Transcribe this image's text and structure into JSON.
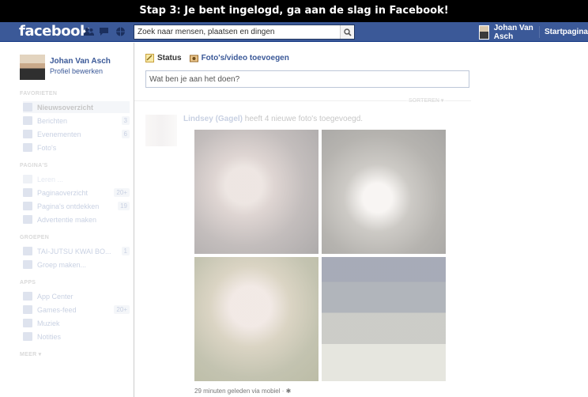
{
  "caption": "Stap 3:  Je bent ingelogd, ga aan de slag in Facebook!",
  "topbar": {
    "logo": "facebook",
    "search_placeholder": "Zoek naar mensen, plaatsen en dingen",
    "user_name": "Johan Van Asch",
    "home_label": "Startpagina",
    "icons": [
      "friend-requests-icon",
      "messages-icon",
      "notifications-icon",
      "search-icon"
    ],
    "colors": {
      "bar": "#3b5998",
      "link": "#3b5998"
    }
  },
  "sidebar": {
    "profile_name": "Johan Van Asch",
    "profile_edit": "Profiel bewerken",
    "sections": [
      {
        "title": "FAVORIETEN",
        "items": [
          {
            "label": "Nieuwsoverzicht",
            "selected": true
          },
          {
            "label": "Berichten",
            "count": "3"
          },
          {
            "label": "Evenementen",
            "count": "6"
          },
          {
            "label": "Foto's"
          }
        ]
      },
      {
        "title": "PAGINA'S",
        "items": [
          {
            "label": "Leren ..."
          },
          {
            "label": "Paginaoverzicht",
            "count": "20+"
          },
          {
            "label": "Pagina's ontdekken",
            "count": "19"
          },
          {
            "label": "Advertentie maken"
          }
        ]
      },
      {
        "title": "GROEPEN",
        "items": [
          {
            "label": "TAI-JUTSU KWAI BO...",
            "count": "1"
          },
          {
            "label": "Groep maken..."
          }
        ]
      },
      {
        "title": "APPS",
        "items": [
          {
            "label": "App Center"
          },
          {
            "label": "Games-feed",
            "count": "20+"
          },
          {
            "label": "Muziek"
          },
          {
            "label": "Notities"
          }
        ]
      }
    ],
    "more": "MEER ▾"
  },
  "composer": {
    "tab_status": "Status",
    "tab_photo": "Foto's/video toevoegen",
    "placeholder": "Wat ben je aan het doen?"
  },
  "feed": {
    "sort_label": "SORTEREN ▾",
    "story": {
      "actor": "Lindsey (Gagel)",
      "verb": " heeft 4 nieuwe foto's toegevoegd.",
      "footer": "29 minuten geleden via mobiel · ✱"
    }
  }
}
